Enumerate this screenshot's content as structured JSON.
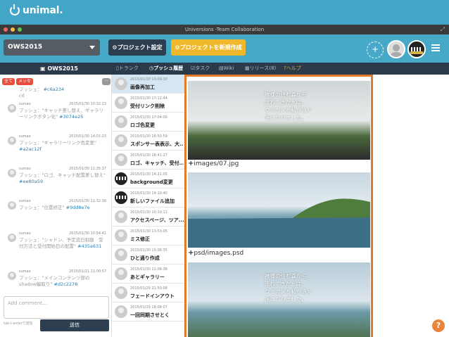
{
  "brand": {
    "logo_text": "unimal."
  },
  "window": {
    "title": "Universions -Team Collaboration",
    "dots": [
      "#ed6a5e",
      "#f5bf4f",
      "#61c554"
    ]
  },
  "appbar": {
    "project": "OWS2015",
    "settings_label": "プロジェクト設定",
    "new_label": "プロジェクトを新規作成"
  },
  "tabbar": {
    "project_title": "OWS2015",
    "tabs": [
      {
        "label": "トランク"
      },
      {
        "label": "プッシュ履歴"
      },
      {
        "label": "タスク"
      },
      {
        "label": "Wiki"
      },
      {
        "label": "リリース(8)"
      },
      {
        "label": "ヘルプ"
      }
    ]
  },
  "left": {
    "filter_all": "全て",
    "filter_msg": "メッセージ",
    "partial_text": "プッシュ：",
    "partial_hash": "#c6a234",
    "partial_tail": "cd",
    "entries": [
      {
        "user": "sumao",
        "time": "2015/01/30 10:32:23",
        "text": "プッシュ：\"キャッチ差し替え、ギャラリーリンクボタン化\"",
        "hash": "#3074e25"
      },
      {
        "user": "sumao",
        "time": "2015/01/30 14:01:23",
        "text": "プッシュ：\"ギャラリーリンク色変更\"",
        "hash": "#a2ac12f"
      },
      {
        "user": "sumao",
        "time": "2015/01/30 11:35:37",
        "text": "プッシュ：\"ロゴ、キャッチ配置差し替え\"",
        "hash": "#ee80a59"
      },
      {
        "user": "sumao",
        "time": "2015/01/30 11:32:30",
        "text": "プッシュ：\"位置修正\"",
        "hash": "#9dd8e7e"
      },
      {
        "user": "sumao",
        "time": "2015/01/30 10:54:41",
        "text": "プッシュ：\"シャドン、予定追日割換　受付方法と受付開始日の配置\"",
        "hash": "#435a631"
      },
      {
        "user": "sumao",
        "time": "2015/01/21 11:00:57",
        "text": "プッシュ：\"メインコンテンツ部のshadow編取り\"",
        "hash": "#d2c2278"
      }
    ],
    "comment_placeholder": "Add comment...",
    "hint": "tab＋enterで送信",
    "send": "送信"
  },
  "pushes": [
    {
      "date": "2015/01/30 10:09:30",
      "title": "画像再加工",
      "thumb": "light"
    },
    {
      "date": "2015/01/30 17:12:44",
      "title": "受付リンク削除",
      "thumb": "light"
    },
    {
      "date": "2015/01/30 17:04:00",
      "title": "ロゴ色変更",
      "thumb": "light"
    },
    {
      "date": "2015/01/30 16:50:59",
      "title": "スポンサー表表示、大...",
      "thumb": "light"
    },
    {
      "date": "2015/01/30 16:41:27",
      "title": "ロゴ、キャッチ、受付...",
      "thumb": "light"
    },
    {
      "date": "2015/01/30 14:21:05",
      "title": "background変更",
      "thumb": "dark"
    },
    {
      "date": "2015/01/30 14:10:40",
      "title": "新しいファイル追加",
      "thumb": "dark"
    },
    {
      "date": "2015/01/30 10:10:11",
      "title": "アクセスページ、ツア...",
      "thumb": "light"
    },
    {
      "date": "2015/01/30 13:53:05",
      "title": "ミス修正",
      "thumb": "light"
    },
    {
      "date": "2015/01/30 15:06:35",
      "title": "ひと通り作成",
      "thumb": "light"
    },
    {
      "date": "2015/01/30 11:06:38",
      "title": "あとギャラリー",
      "thumb": "light"
    },
    {
      "date": "2015/01/29 21:50:08",
      "title": "フェードインアウト",
      "thumb": "light"
    },
    {
      "date": "2015/01/29 18:08:07",
      "title": "一回同期させとく",
      "thumb": "light"
    }
  ],
  "preview": {
    "captions": [
      "images/07.jpg",
      "psd/images.psd"
    ],
    "poem": [
      "神様の住む森から",
      "流れてきた水は、",
      "ウミガメと私が泳ぐ",
      "海になりました。"
    ]
  },
  "colors": {
    "brand": "#44a6c6",
    "accent_orange": "#e07b2a",
    "nav_dark": "#2b3a4a"
  }
}
